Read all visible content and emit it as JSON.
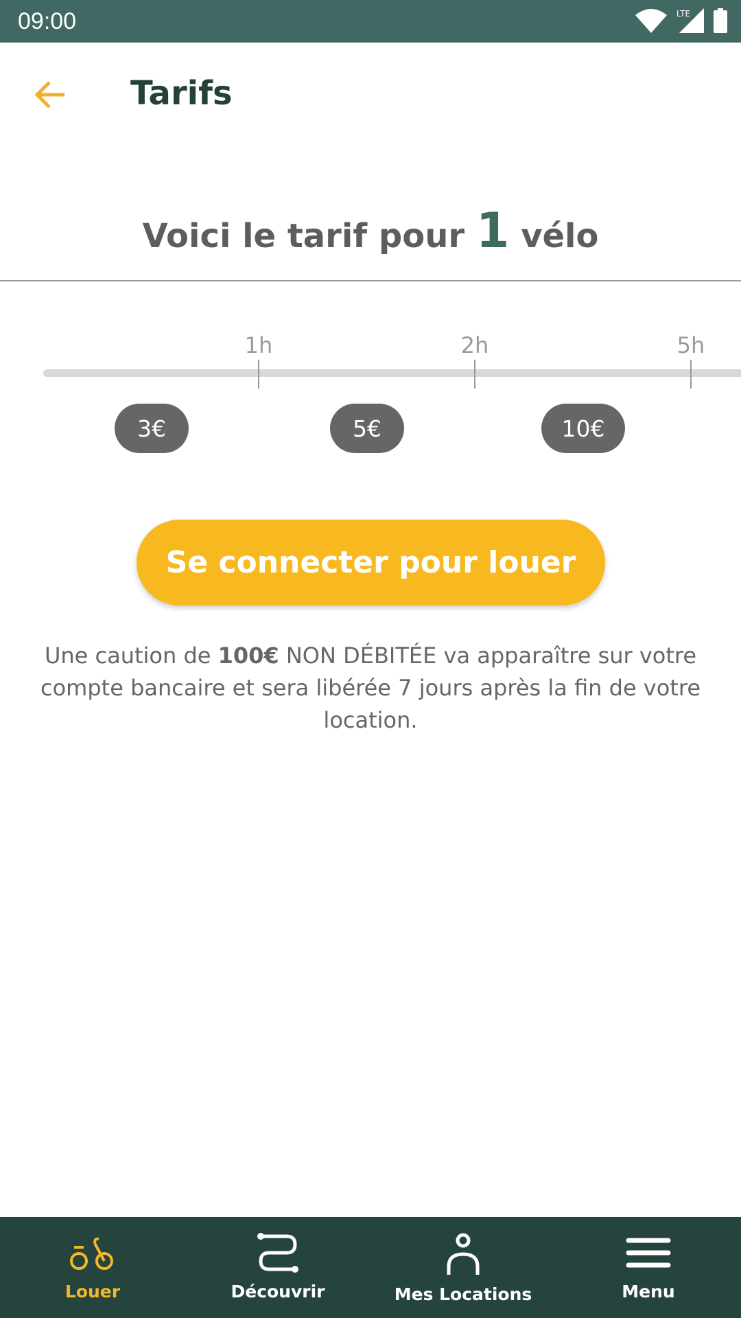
{
  "status_bar": {
    "time": "09:00",
    "network": "LTE"
  },
  "header": {
    "title": "Tarifs",
    "back_icon": "arrow-left-icon"
  },
  "heading": {
    "prefix": "Voici le tarif pour ",
    "count": "1",
    "suffix": " vélo"
  },
  "pricing": {
    "hours": [
      "1h",
      "2h",
      "5h"
    ],
    "prices": [
      "3€",
      "5€",
      "10€"
    ]
  },
  "cta": {
    "label": "Se connecter pour louer"
  },
  "note": {
    "part1": "Une caution de ",
    "amount": "100€",
    "part2": " NON DÉBITÉE va apparaître sur votre compte bancaire et sera libérée 7 jours après la fin de votre location."
  },
  "nav": {
    "items": [
      {
        "label": "Louer",
        "icon": "bike-icon",
        "active": true
      },
      {
        "label": "Découvrir",
        "icon": "route-icon"
      },
      {
        "label": "Mes Locations",
        "icon": "person-icon"
      },
      {
        "label": "Menu",
        "icon": "menu-icon"
      }
    ]
  },
  "colors": {
    "accent": "#f8b81f",
    "nav_bg": "#26443e",
    "status_bg": "#416862",
    "teal": "#3d6b60"
  }
}
